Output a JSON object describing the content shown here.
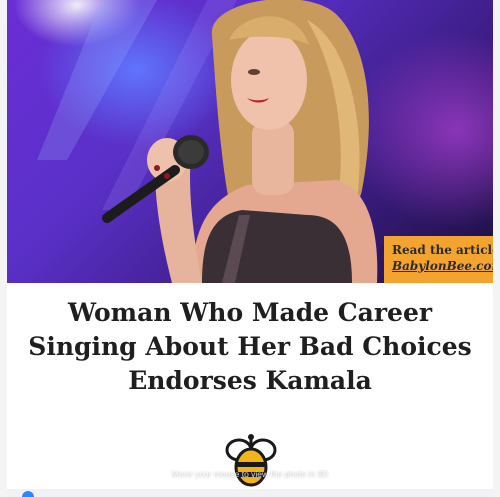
{
  "post": {
    "photo_credit": {
      "line1": "Read the article",
      "line2": "BabylonBee.com"
    },
    "headline": {
      "line1": "Woman Who Made Career",
      "line2": "Singing About Her Bad Choices",
      "line3": "Endorses Kamala"
    },
    "hint": "Move your mouse to view the photo in 3D",
    "logo_icon": "bee-logo-icon"
  },
  "colors": {
    "credit_bg": "#f3a330",
    "headline": "#1f1f1f",
    "stage_purple": "#5a30c8"
  }
}
